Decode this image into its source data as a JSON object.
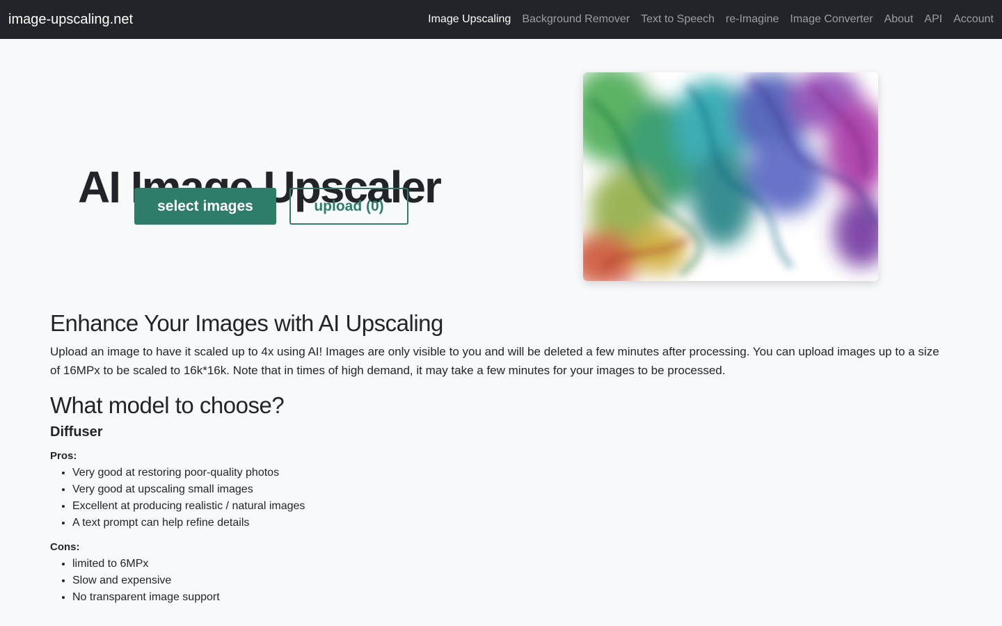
{
  "navbar": {
    "brand": "image-upscaling.net",
    "links": [
      {
        "label": "Image Upscaling",
        "active": true
      },
      {
        "label": "Background Remover"
      },
      {
        "label": "Text to Speech"
      },
      {
        "label": "re-Imagine"
      },
      {
        "label": "Image Converter"
      },
      {
        "label": "About"
      },
      {
        "label": "API"
      },
      {
        "label": "Account"
      }
    ]
  },
  "hero": {
    "title": "AI Image Upscaler",
    "select_button": "select images",
    "upload_button": "upload (0)"
  },
  "intro": {
    "heading": "Enhance Your Images with AI Upscaling",
    "text": "Upload an image to have it scaled up to 4x using AI! Images are only visible to you and will be deleted a few minutes after processing. You can upload images up to a size of 16MPx to be scaled to 16k*16k. Note that in times of high demand, it may take a few minutes for your images to be processed."
  },
  "models": {
    "heading": "What model to choose?",
    "diffuser": {
      "name": "Diffuser",
      "pros_label": "Pros:",
      "pros": [
        "Very good at restoring poor-quality photos",
        "Very good at upscaling small images",
        "Excellent at producing realistic / natural images",
        "A text prompt can help refine details"
      ],
      "cons_label": "Cons:",
      "cons": [
        "limited to 6MPx",
        "Slow and expensive",
        "No transparent image support"
      ]
    }
  },
  "colors": {
    "navbar_bg": "#212529",
    "accent": "#2e7d6b",
    "page_bg": "#f8f9fa"
  }
}
